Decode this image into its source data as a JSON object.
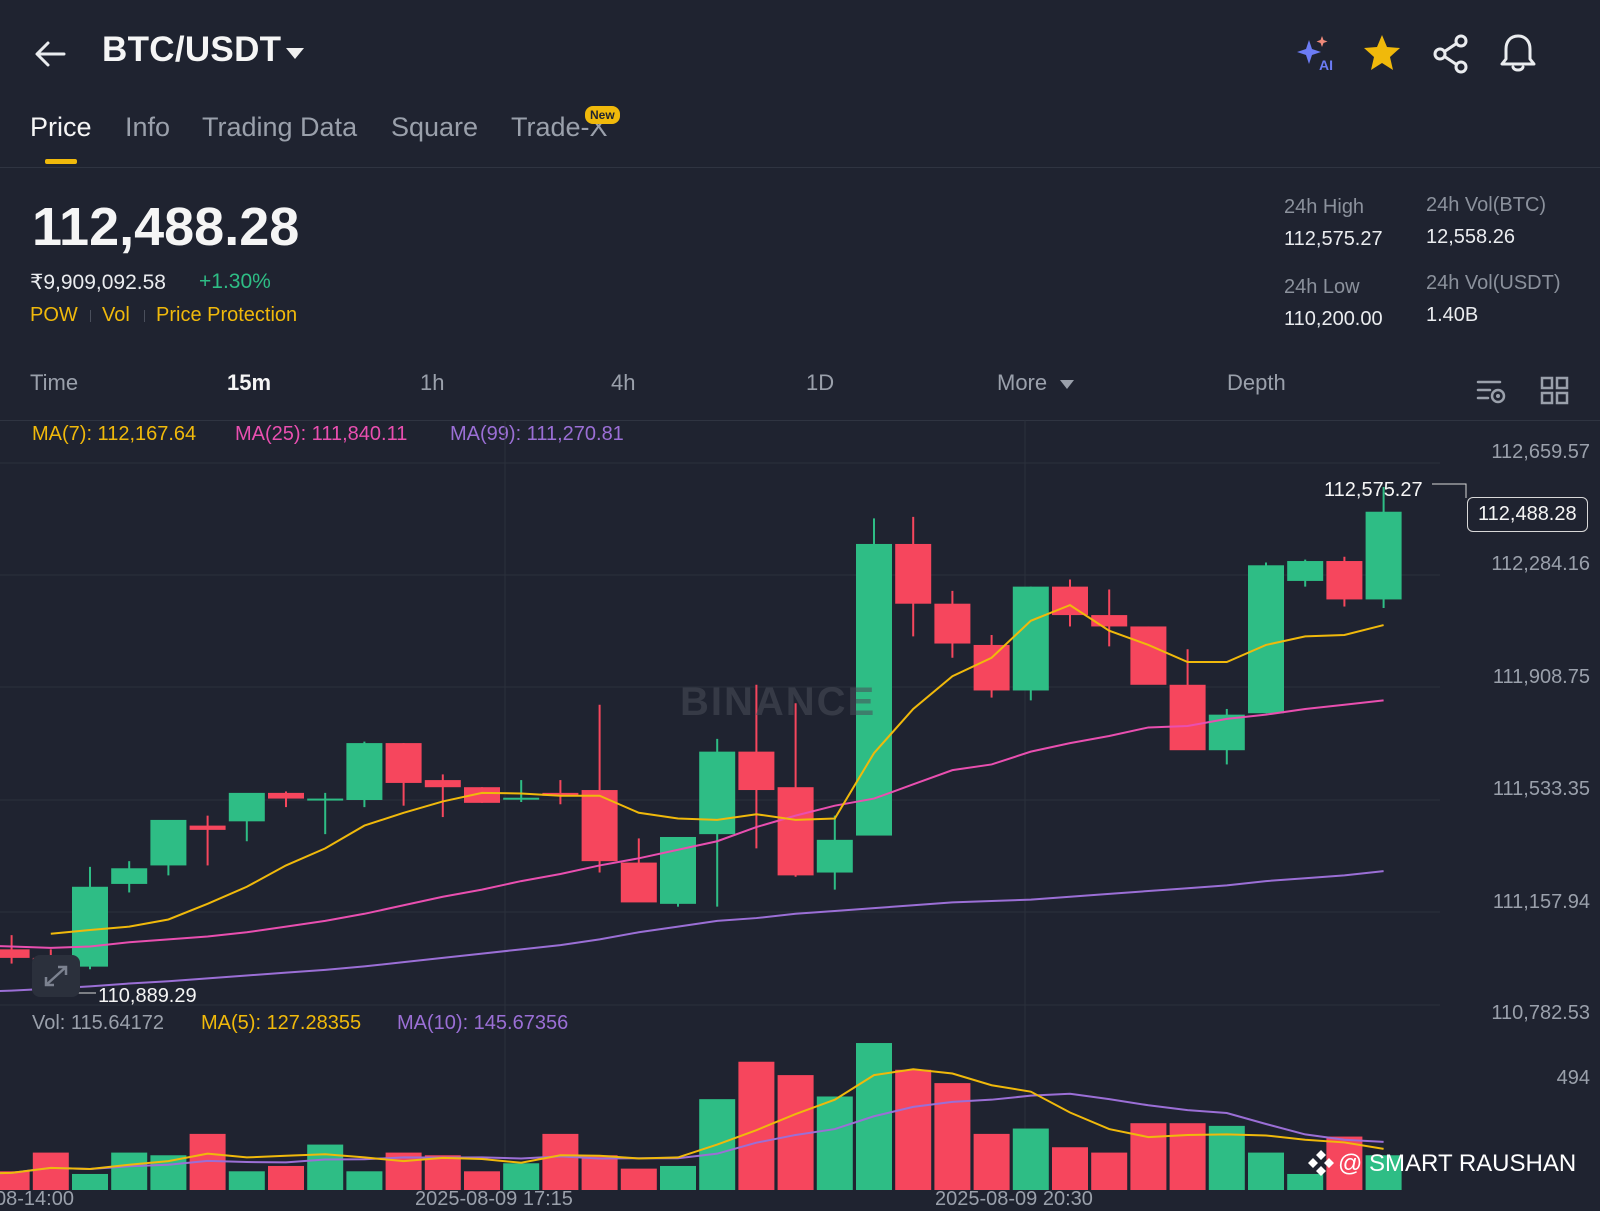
{
  "header": {
    "pair": "BTC/USDT",
    "icons": [
      "back-arrow-icon",
      "chevron-down-icon",
      "ai-sparkle-icon",
      "star-icon",
      "share-icon",
      "bell-icon"
    ],
    "ai_label": "AI"
  },
  "tabs": [
    {
      "label": "Price",
      "active": true
    },
    {
      "label": "Info"
    },
    {
      "label": "Trading Data"
    },
    {
      "label": "Square"
    },
    {
      "label": "Trade-X",
      "badge": "New"
    }
  ],
  "price": {
    "last": "112,488.28",
    "inr": "₹9,909,092.58",
    "change": "+1.30%",
    "tags": [
      "POW",
      "Vol",
      "Price Protection"
    ]
  },
  "stats": {
    "high_label": "24h High",
    "high": "112,575.27",
    "low_label": "24h Low",
    "low": "110,200.00",
    "vol_btc_label": "24h Vol(BTC)",
    "vol_btc": "12,558.26",
    "vol_usdt_label": "24h Vol(USDT)",
    "vol_usdt": "1.40B"
  },
  "intervals": [
    "Time",
    "15m",
    "1h",
    "4h",
    "1D",
    "More",
    "Depth"
  ],
  "interval_active": "15m",
  "ma_legend": {
    "ma7": "MA(7): 112,167.64",
    "ma25": "MA(25): 111,840.11",
    "ma99": "MA(99): 111,270.81"
  },
  "vol_legend": {
    "vol": "Vol: 115.64172",
    "ma5": "MA(5): 127.28355",
    "ma10": "MA(10): 145.67356"
  },
  "colors": {
    "up": "#2ebd85",
    "down": "#f6465d",
    "ma7": "#f0b90b",
    "ma25": "#e94fb0",
    "ma99": "#9b6fd6",
    "accent": "#f0b90b"
  },
  "axis": {
    "price_ticks": [
      "112,659.57",
      "112,284.16",
      "111,908.75",
      "111,533.35",
      "111,157.94",
      "110,782.53"
    ],
    "vol_tick": "494",
    "last_price_box": "112,488.28",
    "high_marker": "112,575.27",
    "low_marker": "110,889.29"
  },
  "time_labels": [
    "08-14:00",
    "2025-08-09 17:15",
    "2025-08-09 20:30"
  ],
  "watermark": "@ SMART RAUSHAN",
  "chart_watermark": "BINANCE",
  "chart_data": {
    "type": "candlestick",
    "price_range": [
      110782.53,
      112659.57
    ],
    "candles": [
      {
        "o": 110950,
        "h": 111000,
        "l": 110900,
        "c": 110920
      },
      {
        "o": 110920,
        "h": 110950,
        "l": 110870,
        "c": 110889.29
      },
      {
        "o": 110889.29,
        "h": 111240,
        "l": 110880,
        "c": 111170
      },
      {
        "o": 111180,
        "h": 111260,
        "l": 111150,
        "c": 111235
      },
      {
        "o": 111245,
        "h": 111390,
        "l": 111210,
        "c": 111405
      },
      {
        "o": 111385,
        "h": 111420,
        "l": 111245,
        "c": 111370
      },
      {
        "o": 111400,
        "h": 111485,
        "l": 111330,
        "c": 111500
      },
      {
        "o": 111500,
        "h": 111505,
        "l": 111450,
        "c": 111480
      },
      {
        "o": 111480,
        "h": 111500,
        "l": 111355,
        "c": 111480
      },
      {
        "o": 111475,
        "h": 111680,
        "l": 111450,
        "c": 111675
      },
      {
        "o": 111675,
        "h": 111675,
        "l": 111455,
        "c": 111535
      },
      {
        "o": 111545,
        "h": 111565,
        "l": 111415,
        "c": 111520
      },
      {
        "o": 111520,
        "h": 111520,
        "l": 111465,
        "c": 111465
      },
      {
        "o": 111480,
        "h": 111545,
        "l": 111468,
        "c": 111483
      },
      {
        "o": 111500,
        "h": 111545,
        "l": 111460,
        "c": 111490
      },
      {
        "o": 111510,
        "h": 111810,
        "l": 111220,
        "c": 111260
      },
      {
        "o": 111255,
        "h": 111340,
        "l": 111130,
        "c": 111115
      },
      {
        "o": 111110,
        "h": 111340,
        "l": 111100,
        "c": 111345
      },
      {
        "o": 111355,
        "h": 111690,
        "l": 111100,
        "c": 111645
      },
      {
        "o": 111645,
        "h": 111880,
        "l": 111305,
        "c": 111510
      },
      {
        "o": 111520,
        "h": 111815,
        "l": 111205,
        "c": 111210
      },
      {
        "o": 111220,
        "h": 111420,
        "l": 111160,
        "c": 111335
      },
      {
        "o": 111350,
        "h": 112465,
        "l": 111350,
        "c": 112375
      },
      {
        "o": 112375,
        "h": 112470,
        "l": 112050,
        "c": 112165
      },
      {
        "o": 112165,
        "h": 112210,
        "l": 111975,
        "c": 112025
      },
      {
        "o": 112020,
        "h": 112055,
        "l": 111835,
        "c": 111860
      },
      {
        "o": 111860,
        "h": 112225,
        "l": 111825,
        "c": 112225
      },
      {
        "o": 112225,
        "h": 112250,
        "l": 112085,
        "c": 112125
      },
      {
        "o": 112125,
        "h": 112215,
        "l": 112015,
        "c": 112085
      },
      {
        "o": 112085,
        "h": 112085,
        "l": 111885,
        "c": 111880
      },
      {
        "o": 111880,
        "h": 112005,
        "l": 111715,
        "c": 111650
      },
      {
        "o": 111650,
        "h": 111795,
        "l": 111600,
        "c": 111775
      },
      {
        "o": 111780,
        "h": 112310,
        "l": 111780,
        "c": 112300
      },
      {
        "o": 112245,
        "h": 112320,
        "l": 112225,
        "c": 112315
      },
      {
        "o": 112315,
        "h": 112330,
        "l": 112155,
        "c": 112180
      },
      {
        "o": 112180,
        "h": 112575.27,
        "l": 112150,
        "c": 112488.28
      }
    ],
    "ma7": [
      111005,
      111018,
      111030,
      111055,
      111110,
      111170,
      111245,
      111305,
      111385,
      111430,
      111470,
      111500,
      111498,
      111490,
      111490,
      111430,
      111410,
      111405,
      111425,
      111405,
      111410,
      111640,
      111795,
      111910,
      111975,
      112105,
      112160,
      112070,
      112020,
      111960,
      111960,
      112020,
      112050,
      112055,
      112090
    ],
    "ma25": [
      110965,
      110960,
      110955,
      110960,
      110975,
      110985,
      110995,
      111010,
      111030,
      111050,
      111075,
      111105,
      111135,
      111160,
      111190,
      111215,
      111245,
      111270,
      111300,
      111330,
      111380,
      111420,
      111455,
      111480,
      111530,
      111580,
      111600,
      111645,
      111675,
      111700,
      111730,
      111735,
      111760,
      111775,
      111795,
      111810,
      111825
    ],
    "ma99": [
      110800,
      110805,
      110812,
      110820,
      110830,
      110838,
      110848,
      110858,
      110868,
      110878,
      110890,
      110905,
      110920,
      110935,
      110950,
      110965,
      110985,
      111010,
      111030,
      111050,
      111060,
      111075,
      111085,
      111095,
      111105,
      111115,
      111120,
      111125,
      111135,
      111145,
      111155,
      111165,
      111175,
      111190,
      111200,
      111210,
      111225
    ]
  },
  "volume_data": {
    "max": 494,
    "bars": [
      60,
      62,
      70,
      140,
      60,
      140,
      130,
      210,
      70,
      90,
      170,
      70,
      140,
      130,
      70,
      100,
      210,
      130,
      80,
      90,
      340,
      480,
      430,
      350,
      550,
      450,
      400,
      210,
      230,
      160,
      140,
      250,
      250,
      240,
      140,
      60,
      200,
      130
    ]
  }
}
